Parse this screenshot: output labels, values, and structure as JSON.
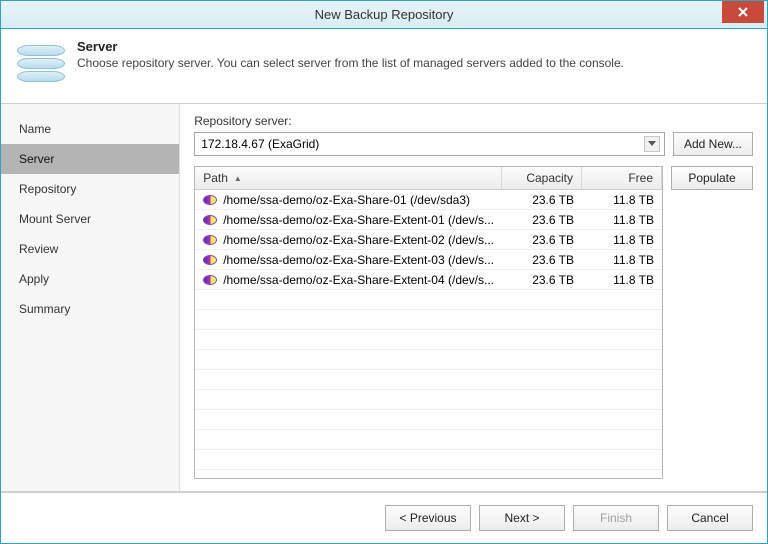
{
  "window": {
    "title": "New Backup Repository"
  },
  "header": {
    "title": "Server",
    "subtitle": "Choose repository server. You can select server from the list of managed servers added to the console."
  },
  "nav": {
    "items": [
      {
        "label": "Name",
        "active": false
      },
      {
        "label": "Server",
        "active": true
      },
      {
        "label": "Repository",
        "active": false
      },
      {
        "label": "Mount Server",
        "active": false
      },
      {
        "label": "Review",
        "active": false
      },
      {
        "label": "Apply",
        "active": false
      },
      {
        "label": "Summary",
        "active": false
      }
    ]
  },
  "content": {
    "server_label": "Repository server:",
    "server_value": "172.18.4.67 (ExaGrid)",
    "add_new_label": "Add New...",
    "populate_label": "Populate",
    "grid": {
      "columns": {
        "path": "Path",
        "capacity": "Capacity",
        "free": "Free"
      },
      "rows": [
        {
          "path": "/home/ssa-demo/oz-Exa-Share-01 (/dev/sda3)",
          "capacity": "23.6 TB",
          "free": "11.8 TB"
        },
        {
          "path": "/home/ssa-demo/oz-Exa-Share-Extent-01 (/dev/s...",
          "capacity": "23.6 TB",
          "free": "11.8 TB"
        },
        {
          "path": "/home/ssa-demo/oz-Exa-Share-Extent-02 (/dev/s...",
          "capacity": "23.6 TB",
          "free": "11.8 TB"
        },
        {
          "path": "/home/ssa-demo/oz-Exa-Share-Extent-03 (/dev/s...",
          "capacity": "23.6 TB",
          "free": "11.8 TB"
        },
        {
          "path": "/home/ssa-demo/oz-Exa-Share-Extent-04 (/dev/s...",
          "capacity": "23.6 TB",
          "free": "11.8 TB"
        }
      ]
    }
  },
  "footer": {
    "previous": "< Previous",
    "next": "Next >",
    "finish": "Finish",
    "cancel": "Cancel"
  }
}
